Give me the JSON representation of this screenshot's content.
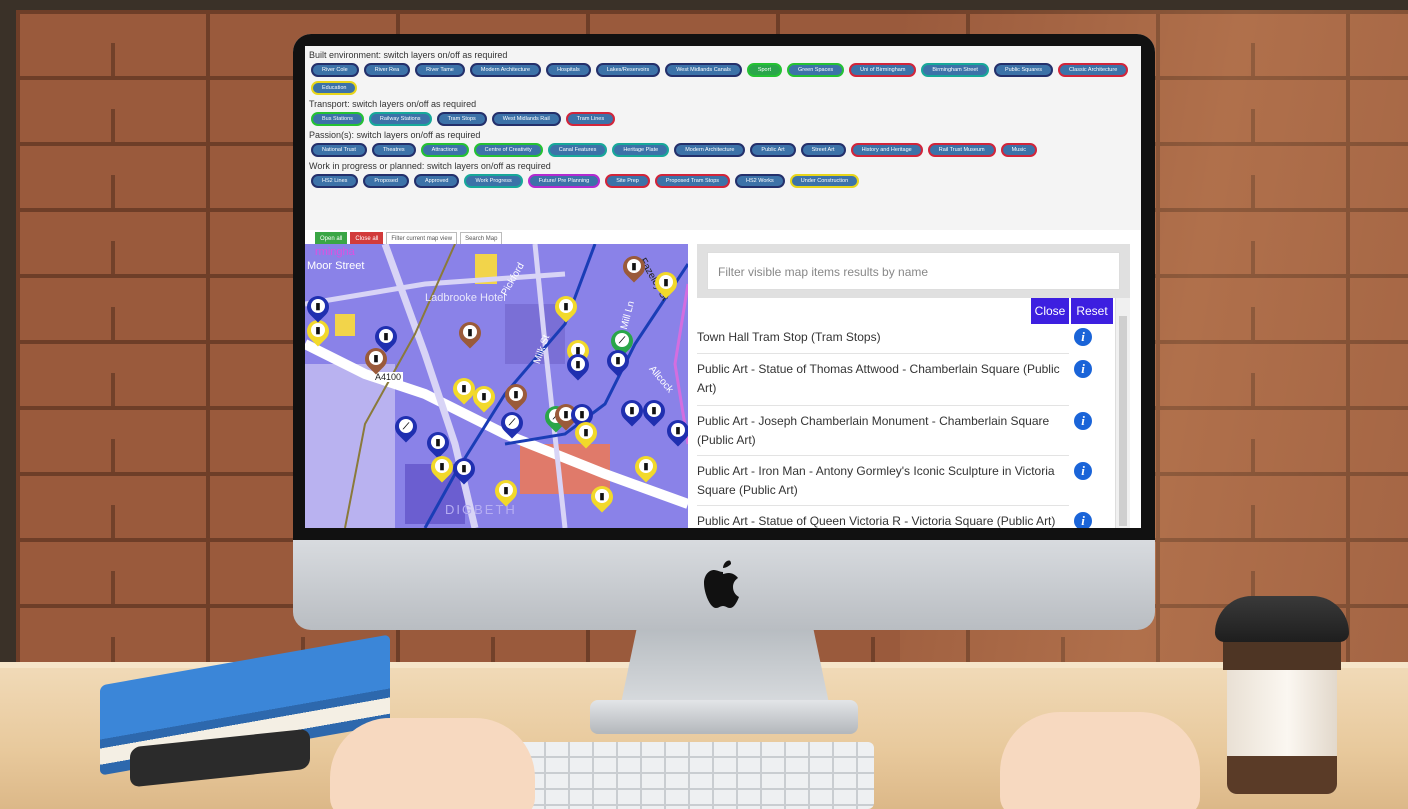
{
  "controls": {
    "sections": [
      {
        "label": "Built environment: switch layers on/off as required",
        "buttons": [
          "River Cole",
          "River Rea",
          "River Tame",
          "Modern Architecture",
          "Hospitals",
          "Lakes/Reservoirs",
          "West Midlands Canals",
          "Sport",
          "Green Spaces",
          "Uni of Birmingham",
          "Birmingham Street",
          "Public Squares",
          "Classic Architecture",
          "Education"
        ]
      },
      {
        "label": "Transport: switch layers on/off as required",
        "buttons": [
          "Bus Stations",
          "Railway Stations",
          "Tram Stops",
          "West Midlands Rail",
          "Tram Lines"
        ]
      },
      {
        "label": "Passion(s): switch layers on/off as required",
        "buttons": [
          "National Trust",
          "Theatres",
          "Attractions",
          "Centre of Creativity",
          "Canal Features",
          "Heritage Plate",
          "Modern Architecture",
          "Public Art",
          "Street Art",
          "History and Heritage",
          "Rail Trust Museum",
          "Music"
        ]
      },
      {
        "label": "Work in progress or planned: switch layers on/off as required",
        "buttons": [
          "HS2 Lines",
          "Proposed",
          "Approved",
          "Work Progress",
          "Future/ Pre Planning",
          "Site Prep",
          "Proposed Tram Stops",
          "HS2 Works",
          "Under Construction"
        ]
      }
    ],
    "toolbar": {
      "open_all": "Open all",
      "close_all": "Close all",
      "filter_view": "Filter current map view",
      "search_map": "Search Map"
    }
  },
  "map": {
    "labels": [
      "rmingha",
      "Moor Street",
      "Ladbrooke Hotel",
      "Milk St",
      "Pickford",
      "Fazeley St",
      "Allcock",
      "Heath Mill Ln",
      "A4100",
      "DIGBETH"
    ]
  },
  "results": {
    "filter_placeholder": "Filter visible map items results by name",
    "close_label": "Close",
    "reset_label": "Reset",
    "items": [
      "Town Hall Tram Stop (Tram Stops)",
      "Public Art - Statue of Thomas Attwood - Chamberlain Square (Public Art)",
      "Public Art - Joseph Chamberlain Monument - Chamberlain Square (Public Art)",
      "Public Art - Iron Man - Antony Gormley's Iconic Sculpture in Victoria Square (Public Art)",
      "Public Art - Statue of Queen Victoria R - Victoria Square (Public Art)"
    ],
    "info_glyph": "i"
  },
  "colors": {
    "accent_button": "#3d1fe0",
    "pill_fill": "#3c72a8",
    "map_base": "#8a82e8",
    "open_all": "#3aa645",
    "close_all": "#d23b3b"
  }
}
